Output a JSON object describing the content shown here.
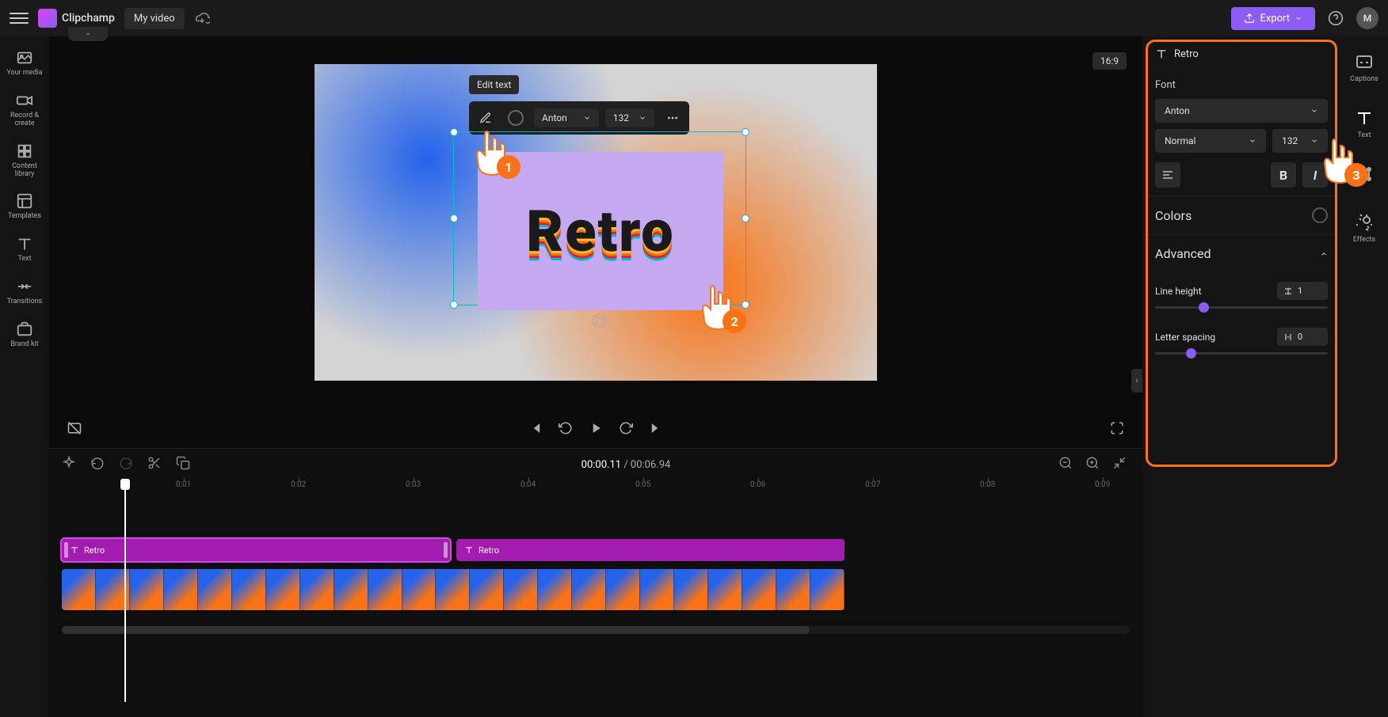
{
  "app": {
    "name": "Clipchamp",
    "title": "My video"
  },
  "topbar": {
    "export": "Export",
    "avatar_initial": "M"
  },
  "aspect": "16:9",
  "sidebar": {
    "items": [
      {
        "label": "Your media"
      },
      {
        "label": "Record & create"
      },
      {
        "label": "Content library"
      },
      {
        "label": "Templates"
      },
      {
        "label": "Text"
      },
      {
        "label": "Transitions"
      },
      {
        "label": "Brand kit"
      }
    ]
  },
  "canvas": {
    "tooltip": "Edit text",
    "sample_text": "Retro",
    "toolbar": {
      "font": "Anton",
      "size": "132"
    }
  },
  "playback": {
    "current": "00:00.11",
    "sep": "/",
    "total": "00:06.94"
  },
  "timeline": {
    "ticks": [
      "0:01",
      "0:02",
      "0:03",
      "0:04",
      "0:05",
      "0:06",
      "0:07",
      "0:08",
      "0:09"
    ],
    "clip1_label": "Retro",
    "clip2_label": "Retro"
  },
  "props": {
    "title": "Retro",
    "font_section": "Font",
    "font": "Anton",
    "weight": "Normal",
    "size": "132",
    "bold": "B",
    "italic": "I",
    "colors_label": "Colors",
    "advanced_label": "Advanced",
    "line_height_label": "Line height",
    "line_height_value": "1",
    "letter_spacing_label": "Letter spacing",
    "letter_spacing_value": "0"
  },
  "right": {
    "items": [
      {
        "label": "Captions"
      },
      {
        "label": "Text"
      },
      {
        "label": ""
      },
      {
        "label": "Effects"
      }
    ]
  },
  "annotations": {
    "p1": "1",
    "p2": "2",
    "p3": "3"
  }
}
